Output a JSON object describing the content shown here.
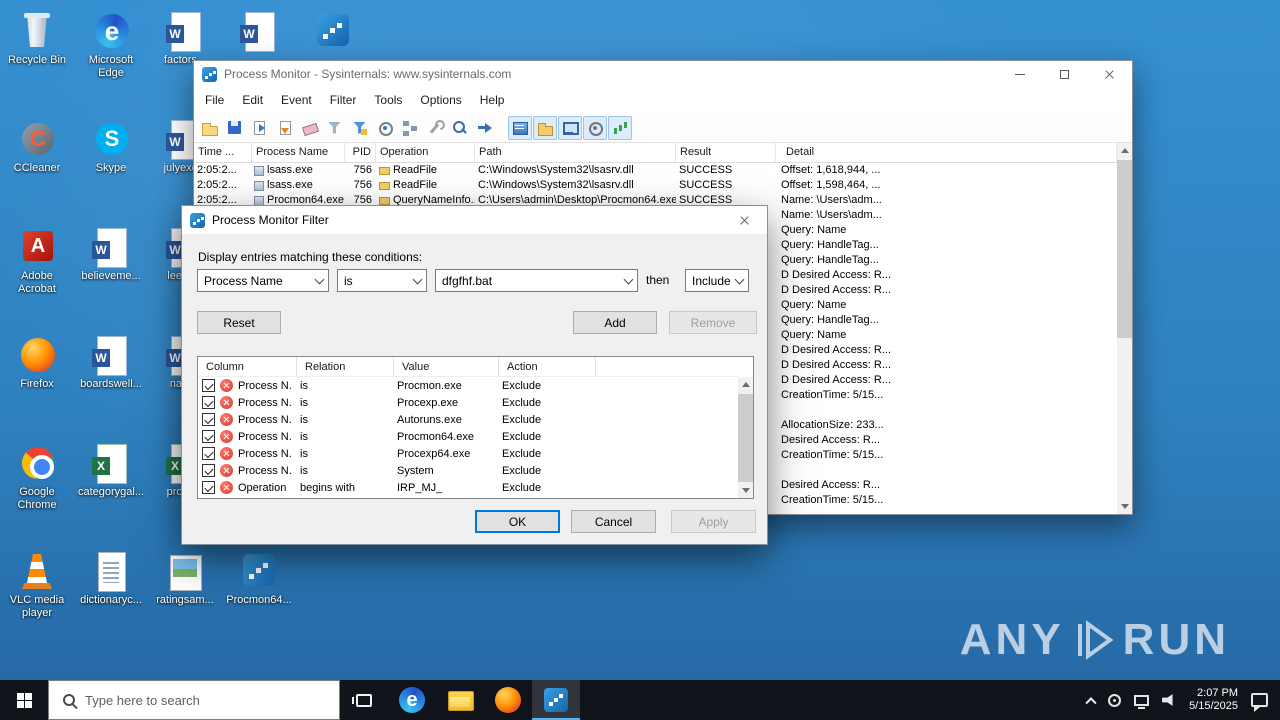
{
  "desktop": {
    "icons": [
      {
        "label": "Recycle Bin",
        "kind": "recycle",
        "col": 1,
        "row": 1
      },
      {
        "label": "Microsoft Edge",
        "kind": "edge",
        "col": 2,
        "row": 1
      },
      {
        "label": "factors...",
        "kind": "word",
        "col": 3,
        "row": 1
      },
      {
        "label": "",
        "kind": "word",
        "col": 4,
        "row": 1
      },
      {
        "label": "",
        "kind": "procmon",
        "col": 5,
        "row": 1
      },
      {
        "label": "CCleaner",
        "kind": "ccleaner",
        "col": 1,
        "row": 2
      },
      {
        "label": "Skype",
        "kind": "skype",
        "col": 2,
        "row": 2
      },
      {
        "label": "julyexc...",
        "kind": "word",
        "col": 3,
        "row": 2
      },
      {
        "label": "Adobe Acrobat",
        "kind": "acrobat",
        "col": 1,
        "row": 3
      },
      {
        "label": "believeme...",
        "kind": "word",
        "col": 2,
        "row": 3
      },
      {
        "label": "leenc...",
        "kind": "word",
        "col": 3,
        "row": 3
      },
      {
        "label": "Firefox",
        "kind": "firefox",
        "col": 1,
        "row": 4
      },
      {
        "label": "boardswell...",
        "kind": "word",
        "col": 2,
        "row": 4
      },
      {
        "label": "natu...",
        "kind": "word",
        "col": 3,
        "row": 4
      },
      {
        "label": "Google Chrome",
        "kind": "chrome",
        "col": 1,
        "row": 5
      },
      {
        "label": "categorygal...",
        "kind": "excel",
        "col": 2,
        "row": 5
      },
      {
        "label": "proce...",
        "kind": "excel",
        "col": 3,
        "row": 5
      },
      {
        "label": "VLC media player",
        "kind": "vlc",
        "col": 1,
        "row": 6
      },
      {
        "label": "dictionaryc...",
        "kind": "text",
        "col": 2,
        "row": 6
      },
      {
        "label": "ratingsam...",
        "kind": "image",
        "col": 3,
        "row": 6
      },
      {
        "label": "Procmon64...",
        "kind": "procmon",
        "col": 4,
        "row": 6
      }
    ]
  },
  "procmon": {
    "title": "Process Monitor - Sysinternals: www.sysinternals.com",
    "menu": [
      "File",
      "Edit",
      "Event",
      "Filter",
      "Tools",
      "Options",
      "Help"
    ],
    "toolbar_buttons": [
      "open-icon",
      "save-icon",
      "capture-icon",
      "autoscroll-icon",
      "clear-icon",
      "filter-icon",
      "highlight-icon",
      "include-process-icon",
      "process-tree-icon",
      "wrench-icon",
      "find-icon",
      "jump-icon"
    ],
    "toolbar_toggles": [
      "registry-filter-icon",
      "filesystem-filter-icon",
      "network-filter-icon",
      "process-filter-icon",
      "profiling-filter-icon"
    ],
    "columns": [
      "Time ...",
      "Process Name",
      "PID",
      "Operation",
      "Path",
      "Result",
      "Detail"
    ],
    "events": [
      {
        "time": "2:05:2...",
        "process": "lsass.exe",
        "pid": "756",
        "operation": "ReadFile",
        "path": "C:\\Windows\\System32\\lsasrv.dll",
        "result": "SUCCESS",
        "detail": "Offset: 1,618,944, ..."
      },
      {
        "time": "2:05:2...",
        "process": "lsass.exe",
        "pid": "756",
        "operation": "ReadFile",
        "path": "C:\\Windows\\System32\\lsasrv.dll",
        "result": "SUCCESS",
        "detail": "Offset: 1,598,464, ..."
      },
      {
        "time": "2:05:2...",
        "process": "Procmon64.exe",
        "pid": "756",
        "operation": "QueryNameInfo...",
        "path": "C:\\Users\\admin\\Desktop\\Procmon64.exe",
        "result": "SUCCESS",
        "detail": "Name: \\Users\\adm..."
      },
      {
        "detail": "Name: \\Users\\adm..."
      },
      {
        "detail": "Query: Name"
      },
      {
        "detail": "Query: HandleTag..."
      },
      {
        "detail": "Query: HandleTag..."
      },
      {
        "detail": "D Desired Access: R..."
      },
      {
        "detail": "D Desired Access: R..."
      },
      {
        "detail": "Query: Name"
      },
      {
        "detail": "Query: HandleTag..."
      },
      {
        "detail": "Query: Name"
      },
      {
        "detail": "D Desired Access: R..."
      },
      {
        "detail": "D Desired Access: R..."
      },
      {
        "detail": "D Desired Access: R..."
      },
      {
        "detail": "CreationTime: 5/15..."
      },
      {
        "detail": ""
      },
      {
        "detail": "AllocationSize: 233..."
      },
      {
        "detail": "Desired Access: R..."
      },
      {
        "detail": "CreationTime: 5/15..."
      },
      {
        "detail": ""
      },
      {
        "detail": "Desired Access: R..."
      },
      {
        "detail": "CreationTime: 5/15..."
      }
    ]
  },
  "filter_dialog": {
    "title": "Process Monitor Filter",
    "instruction": "Display entries matching these conditions:",
    "condition": {
      "column": "Process Name",
      "relation": "is",
      "value": "dfgfhf.bat",
      "then_label": "then",
      "action": "Include"
    },
    "buttons": {
      "reset": "Reset",
      "add": "Add",
      "remove": "Remove",
      "ok": "OK",
      "cancel": "Cancel",
      "apply": "Apply"
    },
    "list_columns": [
      "Column",
      "Relation",
      "Value",
      "Action"
    ],
    "rules": [
      {
        "checked": true,
        "column": "Process N...",
        "relation": "is",
        "value": "Procmon.exe",
        "action": "Exclude"
      },
      {
        "checked": true,
        "column": "Process N...",
        "relation": "is",
        "value": "Procexp.exe",
        "action": "Exclude"
      },
      {
        "checked": true,
        "column": "Process N...",
        "relation": "is",
        "value": "Autoruns.exe",
        "action": "Exclude"
      },
      {
        "checked": true,
        "column": "Process N...",
        "relation": "is",
        "value": "Procmon64.exe",
        "action": "Exclude"
      },
      {
        "checked": true,
        "column": "Process N...",
        "relation": "is",
        "value": "Procexp64.exe",
        "action": "Exclude"
      },
      {
        "checked": true,
        "column": "Process N...",
        "relation": "is",
        "value": "System",
        "action": "Exclude"
      },
      {
        "checked": true,
        "column": "Operation",
        "relation": "begins with",
        "value": "IRP_MJ_",
        "action": "Exclude"
      }
    ]
  },
  "taskbar": {
    "search_placeholder": "Type here to search",
    "clock": {
      "time": "2:07 PM",
      "date": "5/15/2025"
    }
  },
  "watermark": {
    "left": "ANY",
    "right": "RUN"
  }
}
